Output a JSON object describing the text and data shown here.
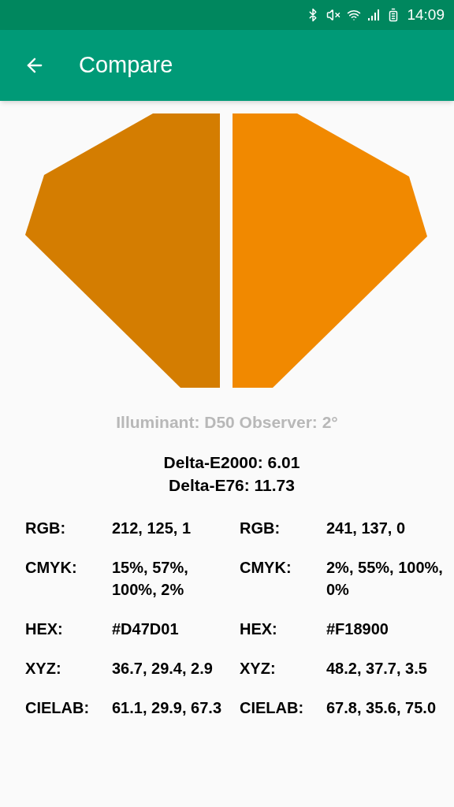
{
  "status_bar": {
    "time": "14:09"
  },
  "app_bar": {
    "title": "Compare"
  },
  "swatches": [
    {
      "color": "#d47d01"
    },
    {
      "color": "#f18900"
    }
  ],
  "conditions": "Illuminant: D50 Observer: 2°",
  "deltas": [
    "Delta-E2000: 6.01",
    "Delta-E76: 11.73"
  ],
  "samples": [
    {
      "rows": [
        {
          "label": "RGB:",
          "value": "212, 125, 1"
        },
        {
          "label": "CMYK:",
          "value": "15%, 57%, 100%, 2%"
        },
        {
          "label": "HEX:",
          "value": "#D47D01"
        },
        {
          "label": "XYZ:",
          "value": "36.7, 29.4, 2.9"
        },
        {
          "label": "CIELAB:",
          "value": "61.1, 29.9, 67.3"
        }
      ]
    },
    {
      "rows": [
        {
          "label": "RGB:",
          "value": "241, 137, 0"
        },
        {
          "label": "CMYK:",
          "value": "2%, 55%, 100%, 0%"
        },
        {
          "label": "HEX:",
          "value": "#F18900"
        },
        {
          "label": "XYZ:",
          "value": "48.2, 37.7, 3.5"
        },
        {
          "label": "CIELAB:",
          "value": "67.8, 35.6, 75.0"
        }
      ]
    }
  ]
}
